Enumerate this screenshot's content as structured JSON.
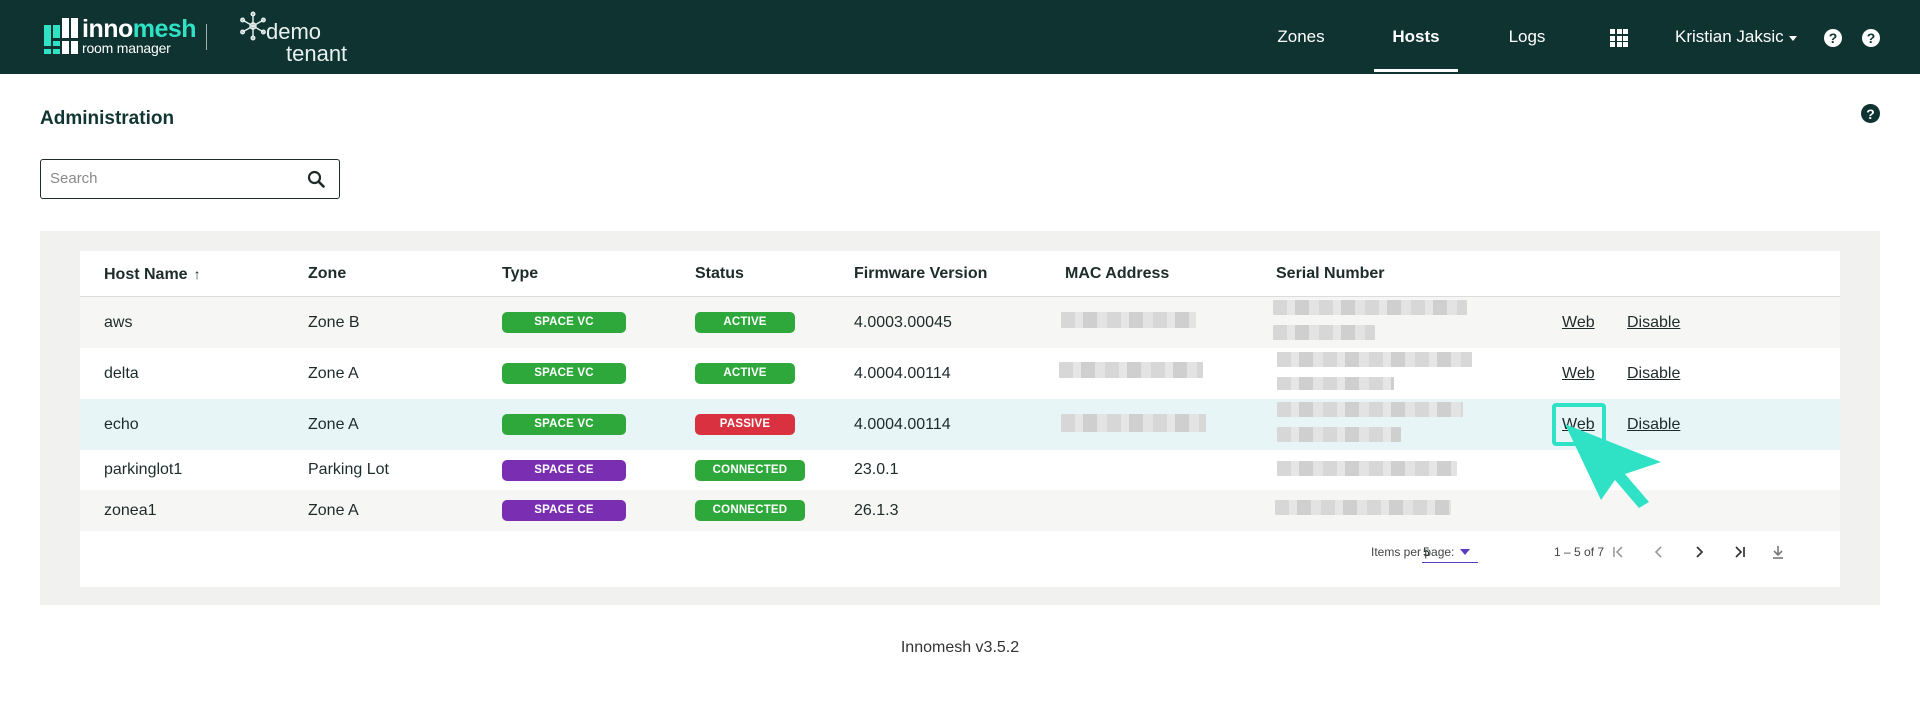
{
  "brand": {
    "name_plain": "inno",
    "name_highlight": "mesh",
    "subtitle": "room manager",
    "tenant_line1": "demo",
    "tenant_line2": "tenant"
  },
  "nav": {
    "items": [
      {
        "label": "Zones",
        "active": false
      },
      {
        "label": "Hosts",
        "active": true
      },
      {
        "label": "Logs",
        "active": false
      }
    ],
    "user": "Kristian Jaksic",
    "help1": "?",
    "help2": "?"
  },
  "page": {
    "title": "Administration",
    "help": "?",
    "search_placeholder": "Search",
    "search_value": ""
  },
  "table": {
    "columns": [
      "Host Name",
      "Zone",
      "Type",
      "Status",
      "Firmware Version",
      "MAC Address",
      "Serial Number"
    ],
    "sort_indicator": "↑",
    "rows": [
      {
        "host": "aws",
        "zone": "Zone B",
        "type": "SPACE VC",
        "status": "ACTIVE",
        "firmware": "4.0003.00045",
        "web": "Web",
        "disable": "Disable"
      },
      {
        "host": "delta",
        "zone": "Zone A",
        "type": "SPACE VC",
        "status": "ACTIVE",
        "firmware": "4.0004.00114",
        "web": "Web",
        "disable": "Disable"
      },
      {
        "host": "echo",
        "zone": "Zone A",
        "type": "SPACE VC",
        "status": "PASSIVE",
        "firmware": "4.0004.00114",
        "web": "Web",
        "disable": "Disable"
      },
      {
        "host": "parkinglot1",
        "zone": "Parking Lot",
        "type": "SPACE CE",
        "status": "CONNECTED",
        "firmware": "23.0.1"
      },
      {
        "host": "zonea1",
        "zone": "Zone A",
        "type": "SPACE CE",
        "status": "CONNECTED",
        "firmware": "26.1.3"
      }
    ]
  },
  "paginator": {
    "items_per_page_label": "Items per page:",
    "page_size": "5",
    "range": "1 – 5 of 7"
  },
  "footer": {
    "version": "Innomesh v3.5.2"
  },
  "colors": {
    "topbar": "#0e3330",
    "accent": "#2fe2c5",
    "space_vc": "#2ea83a",
    "space_ce": "#7a2fb3",
    "active": "#2ea83a",
    "passive": "#d9313f",
    "connected": "#2ea83a",
    "select_underline": "#5b3cc4"
  }
}
